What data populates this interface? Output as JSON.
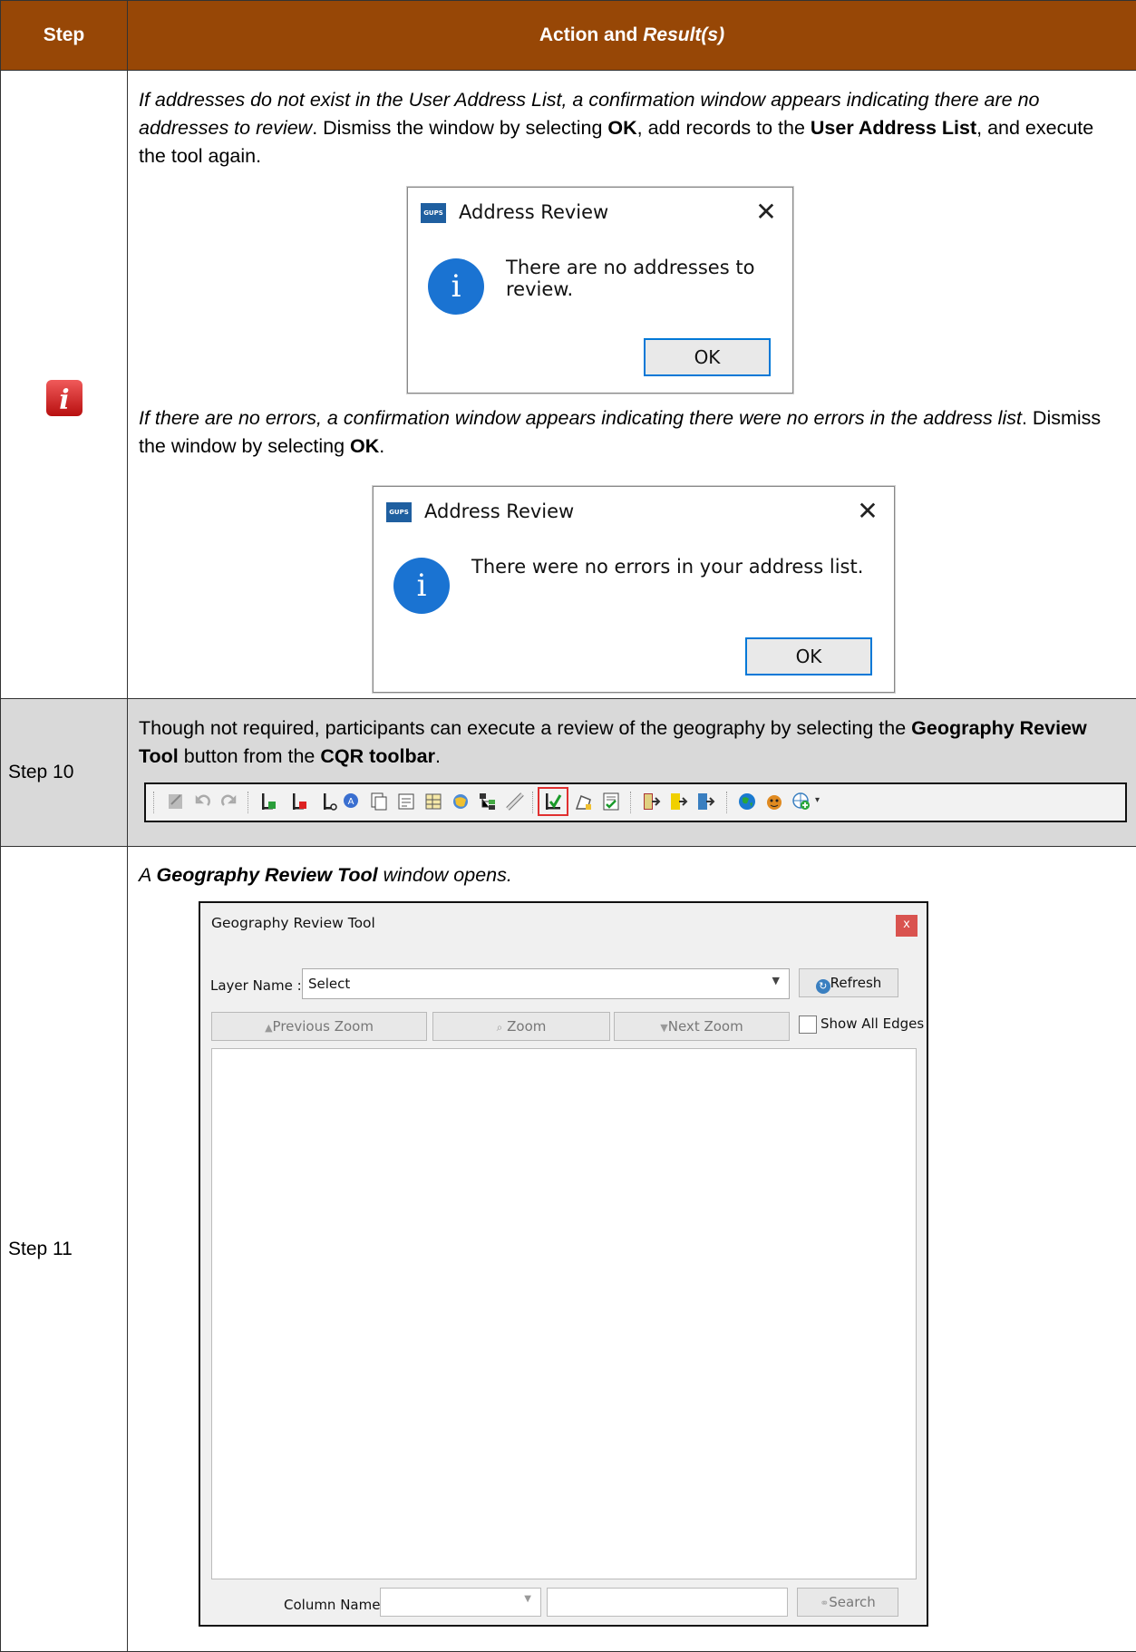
{
  "header": {
    "step": "Step",
    "action": "Action and ",
    "result": "Result(s)"
  },
  "row_info": {
    "icon": "info-icon",
    "para1_italic": "If addresses do not exist in the User Address List, a confirmation window appears indicating there are no addresses to review",
    "para1_a": ". Dismiss the window by selecting ",
    "para1_ok": "OK",
    "para1_b": ", add records to the ",
    "para1_list": "User Address List",
    "para1_c": ", and execute the tool again.",
    "dialog1": {
      "logo": "GUPS",
      "title": "Address Review",
      "message": "There are no addresses to review.",
      "ok": "OK"
    },
    "para2_italic": "If there are no errors, a confirmation window appears indicating there were no errors in the address list",
    "para2_a": ". Dismiss the window by selecting ",
    "para2_ok": "OK",
    "para2_b": ".",
    "dialog2": {
      "logo": "GUPS",
      "title": "Address Review",
      "message": "There were no errors in your address list.",
      "ok": "OK"
    }
  },
  "row_step10": {
    "step": "Step 10",
    "text_a": "Though not required, participants can execute a review of the geography by selecting the ",
    "tool": "Geography Review Tool",
    "text_b": " button from the ",
    "toolbar": "CQR toolbar",
    "text_c": "."
  },
  "row_step11": {
    "step": "Step 11",
    "caption_a": "A ",
    "caption_tool": "Geography Review Tool",
    "caption_b": " window opens.",
    "window": {
      "title": "Geography Review Tool",
      "close": "x",
      "layer_label": "Layer Name :",
      "layer_value": "Select",
      "refresh": "Refresh",
      "prev_zoom": "Previous Zoom",
      "zoom": "Zoom",
      "next_zoom": "Next Zoom",
      "show_all_edges": "Show All Edges",
      "column_label": "Column Name :",
      "search": "Search"
    }
  },
  "colors": {
    "header_bg": "#974706",
    "step10_bg": "#d9d9d9",
    "highlight": "#e03030",
    "info_blue": "#1a73d2"
  }
}
